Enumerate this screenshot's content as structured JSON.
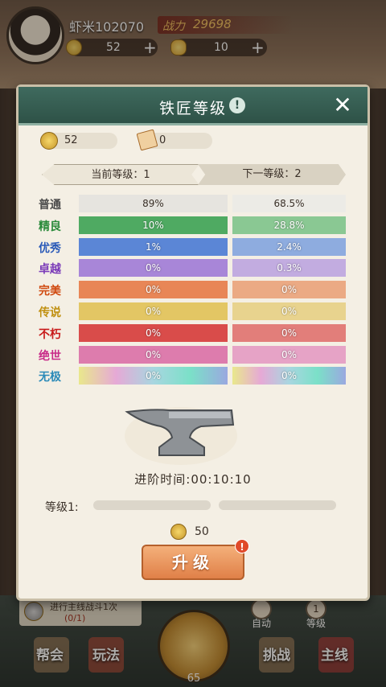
{
  "player": {
    "name": "虾米102070",
    "power_label": "战力",
    "power_value": "29698"
  },
  "resources": {
    "coins": "52",
    "ingots": "10"
  },
  "modal": {
    "title": "铁匠等级",
    "help": "!",
    "close": "✕",
    "coins": "52",
    "scrolls": "0",
    "current_tab": "当前等级：1",
    "next_tab": "下一等级：2",
    "qualities": [
      {
        "name": "普通",
        "color": "#4a4a4a",
        "cur": "89%",
        "nxt": "68.5%",
        "cur_bg": "#e6e4df",
        "nxt_bg": "#ecebe6",
        "text_dark": true
      },
      {
        "name": "精良",
        "color": "#2a8a3a",
        "cur": "10%",
        "nxt": "28.8%",
        "cur_bg": "#4faa62",
        "nxt_bg": "#8ac893"
      },
      {
        "name": "优秀",
        "color": "#2a5ab8",
        "cur": "1%",
        "nxt": "2.4%",
        "cur_bg": "#5b86d6",
        "nxt_bg": "#8eacdf"
      },
      {
        "name": "卓越",
        "color": "#7a3ab8",
        "cur": "0%",
        "nxt": "0.3%",
        "cur_bg": "#a886d8",
        "nxt_bg": "#c2ace0"
      },
      {
        "name": "完美",
        "color": "#d04a10",
        "cur": "0%",
        "nxt": "0%",
        "cur_bg": "#e88656",
        "nxt_bg": "#ebaa84"
      },
      {
        "name": "传说",
        "color": "#c09010",
        "cur": "0%",
        "nxt": "0%",
        "cur_bg": "#e3c664",
        "nxt_bg": "#e8d38e"
      },
      {
        "name": "不朽",
        "color": "#c81a1a",
        "cur": "0%",
        "nxt": "0%",
        "cur_bg": "#d94c4a",
        "nxt_bg": "#e27e7a"
      },
      {
        "name": "绝世",
        "color": "#c82a88",
        "cur": "0%",
        "nxt": "0%",
        "cur_bg": "#dd7cad",
        "nxt_bg": "#e6a3c6"
      },
      {
        "name": "无极",
        "color": "#2a8ab8",
        "cur": "0%",
        "nxt": "0%",
        "cur_bg": "linear-gradient(90deg,#e9e88c,#e6a9d6,#a8d6e0,#7be0c8,#9aa8e0)",
        "nxt_bg": "linear-gradient(90deg,#e9e88c,#e6a9d6,#a8d6e0,#7be0c8,#9aa8e0)"
      }
    ],
    "advance_time": "进阶时间:00:10:10",
    "level_label": "等级1:",
    "upgrade_progress": 0,
    "cost": "50",
    "upgrade_label": "升级",
    "upgrade_badge": "!"
  },
  "bottom": {
    "quest_title": "进行主线战斗1次",
    "quest_progress": "(0/1)",
    "nav": [
      "帮会",
      "玩法",
      "挑战",
      "主线"
    ],
    "center_num": "65",
    "auto": "自动",
    "level": "等级",
    "level_count": "1"
  }
}
